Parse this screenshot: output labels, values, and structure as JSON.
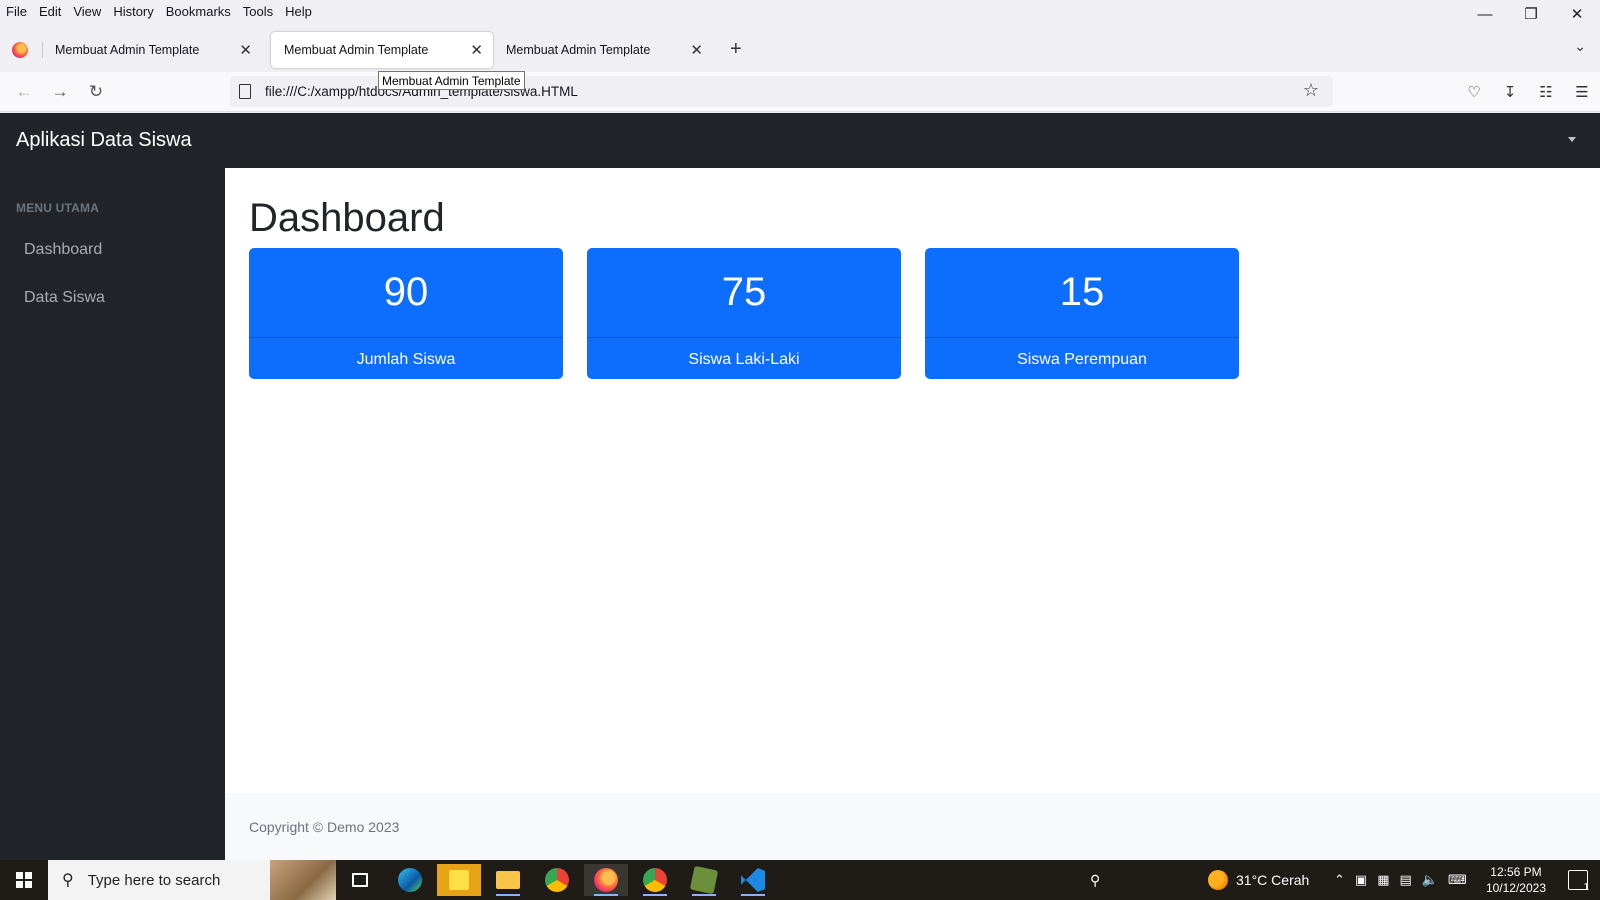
{
  "browser": {
    "menu": [
      "File",
      "Edit",
      "View",
      "History",
      "Bookmarks",
      "Tools",
      "Help"
    ],
    "tabs": [
      {
        "title": "Membuat Admin Template",
        "active": false
      },
      {
        "title": "Membuat Admin Template",
        "active": true
      },
      {
        "title": "Membuat Admin Template",
        "active": false
      }
    ],
    "tooltip": "Membuat Admin Template",
    "url": "file:///C:/xampp/htdocs/Admin_template/siswa.HTML",
    "new_tab": "+"
  },
  "app": {
    "brand": "Aplikasi Data Siswa",
    "sidebar": {
      "heading": "MENU UTAMA",
      "items": [
        "Dashboard",
        "Data Siswa"
      ]
    },
    "title": "Dashboard",
    "cards": [
      {
        "value": "90",
        "label": "Jumlah Siswa"
      },
      {
        "value": "75",
        "label": "Siswa Laki-Laki"
      },
      {
        "value": "15",
        "label": "Siswa Perempuan"
      }
    ],
    "footer": "Copyright © Demo 2023",
    "accent": "#0d6efd"
  },
  "taskbar": {
    "search_placeholder": "Type here to search",
    "weather": "31°C  Cerah",
    "time": "12:56 PM",
    "date": "10/12/2023",
    "notification_count": "1"
  }
}
